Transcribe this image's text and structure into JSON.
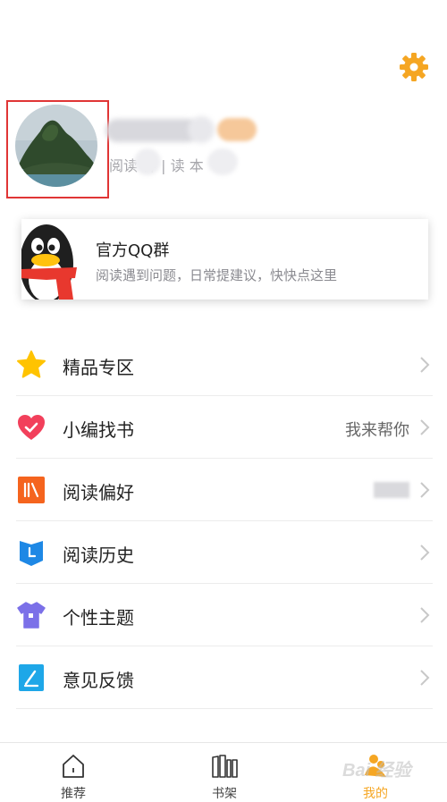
{
  "profile": {
    "stats_text": "阅读   钟 | 读   本"
  },
  "qq_group": {
    "title": "官方QQ群",
    "subtitle": "阅读遇到问题，日常提建议，快快点这里"
  },
  "menu": {
    "items": [
      {
        "label": "精品专区",
        "value": "",
        "icon": "star-icon",
        "color": "#FFC300"
      },
      {
        "label": "小编找书",
        "value": "我来帮你",
        "icon": "heart-icon",
        "color": "#F2405B"
      },
      {
        "label": "阅读偏好",
        "value": "",
        "icon": "books-icon",
        "color": "#F5641E"
      },
      {
        "label": "阅读历史",
        "value": "",
        "icon": "history-book-icon",
        "color": "#1E88E5"
      },
      {
        "label": "个性主题",
        "value": "",
        "icon": "tshirt-icon",
        "color": "#7B70E8"
      },
      {
        "label": "意见反馈",
        "value": "",
        "icon": "feedback-pen-icon",
        "color": "#1EA7E8"
      }
    ]
  },
  "tabbar": {
    "tabs": [
      {
        "label": "推荐",
        "icon": "home-icon",
        "active": false
      },
      {
        "label": "书架",
        "icon": "bookshelf-icon",
        "active": false
      },
      {
        "label": "我的",
        "icon": "profile-icon",
        "active": true
      }
    ]
  },
  "watermark": "Bai 经验",
  "colors": {
    "accent": "#F5A623",
    "highlight_frame": "#E03535"
  }
}
